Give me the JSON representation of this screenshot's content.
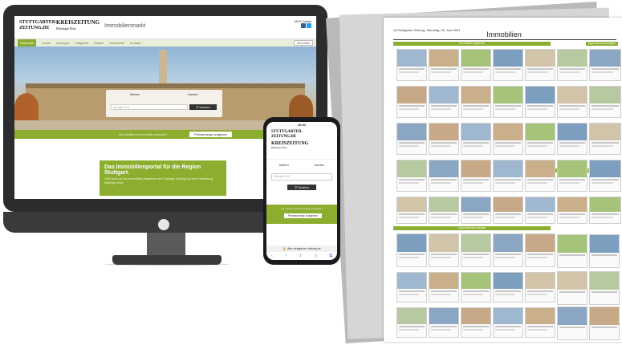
{
  "desktop": {
    "logo_stz": "STUTTGARTER-\nZEITUNG.DE",
    "logo_kz": "KREISZEITUNG",
    "logo_kz_sub": "Böblinger Bote",
    "portal_title": "Immobilienmarkt",
    "head_right": "MHS Digital",
    "nav": [
      "Startseite",
      "Suche",
      "Anzeigen",
      "Ratgeber",
      "Makler",
      "Merkzettel",
      "Kontakt"
    ],
    "merkzettel": "Merkliste",
    "search_tabs": [
      "Mieten",
      "Kaufen"
    ],
    "search_placeholder": "Ort oder PLZ",
    "search_button": "Suchen",
    "green_bar_text": "Sie möchten Ihre Immobilie verkaufen?",
    "green_bar_button": "Preisanzeige aufgeben",
    "promo_title": "Das Immobilienportal für die Region Stuttgart.",
    "promo_text": "Jetzt auch mit den Immobilien-Angeboten der Esslinger Zeitung und der Kreiszeitung Böblinger Bote."
  },
  "phone": {
    "time": "10:31",
    "logo_stz": "STUTTGARTER-\nZEITUNG.DE",
    "logo_kz": "KREISZEITUNG",
    "logo_kz_sub": "Böblinger Bote",
    "tabs": [
      "Mieten",
      "Kaufen"
    ],
    "search_placeholder": "Ort oder PLZ",
    "search_button": "Suchen",
    "green_text": "Sie möchten Ihre Immobilie verkaufen?",
    "green_button": "Preisanzeige aufgeben",
    "url": "tiller-stuttgarter-zeitung.de",
    "icons": [
      "back-icon",
      "forward-icon",
      "share-icon",
      "bookmarks-icon",
      "tabs-icon"
    ]
  },
  "newspaper": {
    "header": "V8   Stuttgarter Zeitung, Samstag, 26. Juni 2021",
    "title": "Immobilien",
    "bands": [
      "Immobilien angebote",
      "Eigentumswohnungen",
      "Ein- und Zweifamilienhäuser",
      "Eigentumswohnungen"
    ]
  },
  "colors": {
    "accent": "#8cae2f",
    "dark": "#2c2c2e"
  }
}
